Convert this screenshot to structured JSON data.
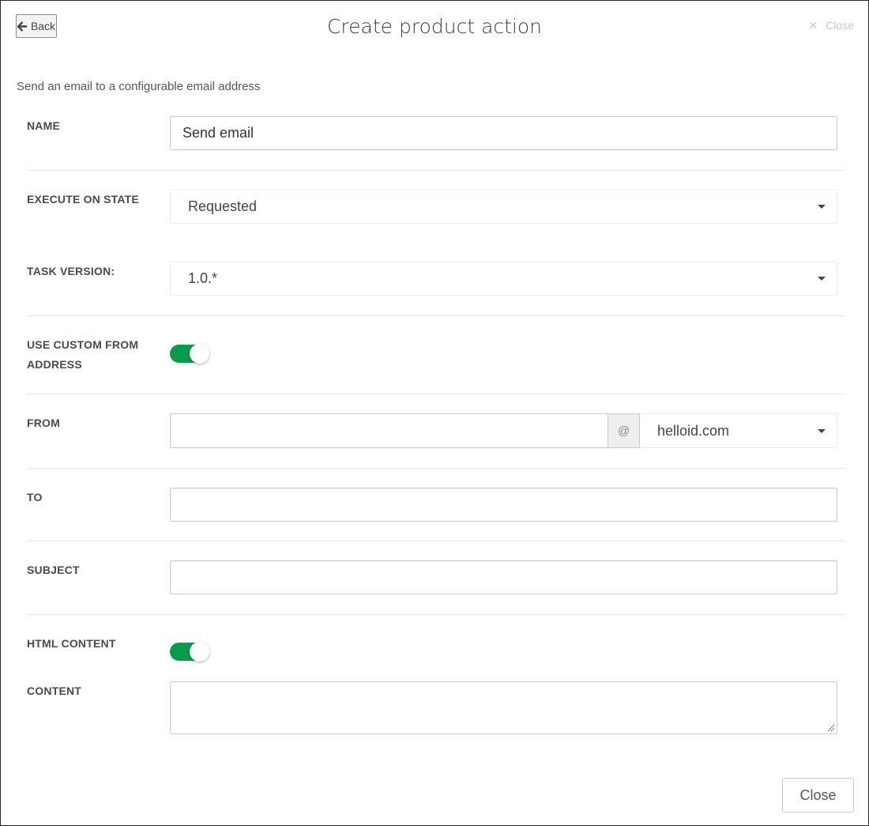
{
  "header": {
    "back_label": "Back",
    "title": "Create product action",
    "close_label": "Close",
    "close_glyph": "✕"
  },
  "description": "Send an email to a configurable email address",
  "form": {
    "name": {
      "label": "NAME",
      "value": "Send email"
    },
    "execute_on_state": {
      "label": "EXECUTE ON STATE",
      "selected": "Requested"
    },
    "task_version": {
      "label": "TASK VERSION:",
      "selected": "1.0.*"
    },
    "use_custom_from": {
      "label_line1": "USE CUSTOM FROM",
      "label_line2": "ADDRESS",
      "checked": true
    },
    "from": {
      "label": "FROM",
      "value": "",
      "at": "@",
      "domain": "helloid.com"
    },
    "to": {
      "label": "TO",
      "value": ""
    },
    "subject": {
      "label": "SUBJECT",
      "value": ""
    },
    "html_content": {
      "label": "HTML CONTENT",
      "checked": true
    },
    "content": {
      "label": "CONTENT",
      "value": ""
    }
  },
  "footer": {
    "close_label": "Close"
  },
  "colors": {
    "toggle_on": "#079c4b",
    "border": "#c8c8c8",
    "label": "#4a4a4a"
  },
  "icons": {
    "back": "arrow-left-icon",
    "close": "close-x-icon",
    "caret": "chevron-down-icon"
  }
}
